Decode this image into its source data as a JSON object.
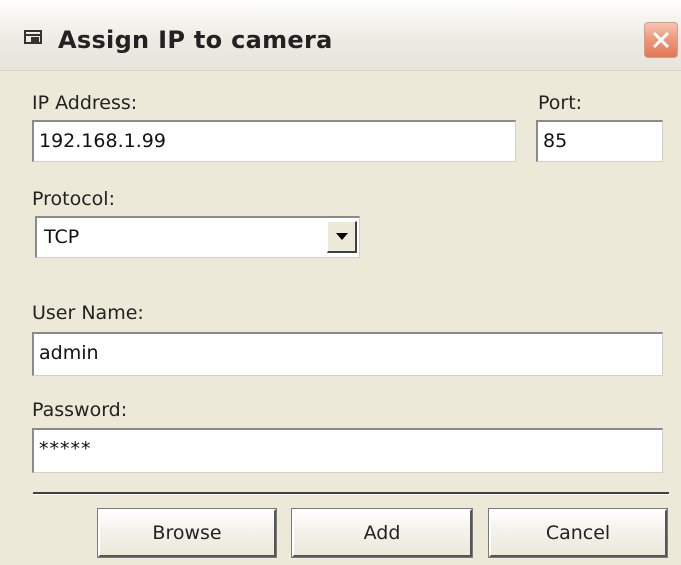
{
  "window": {
    "title": "Assign IP to camera"
  },
  "form": {
    "ip_address": {
      "label": "IP Address:",
      "value": "192.168.1.99"
    },
    "port": {
      "label": "Port:",
      "value": "85"
    },
    "protocol": {
      "label": "Protocol:",
      "value": "TCP"
    },
    "user_name": {
      "label": "User Name:",
      "value": "admin"
    },
    "password": {
      "label": "Password:",
      "value": "*****"
    }
  },
  "buttons": {
    "browse": "Browse",
    "add": "Add",
    "cancel": "Cancel"
  },
  "icons": {
    "window": "camera-window-icon",
    "close": "close-icon",
    "dropdown": "chevron-down-icon"
  },
  "colors": {
    "close_button": "#e27856",
    "dialog_background": "#ece9d8"
  }
}
